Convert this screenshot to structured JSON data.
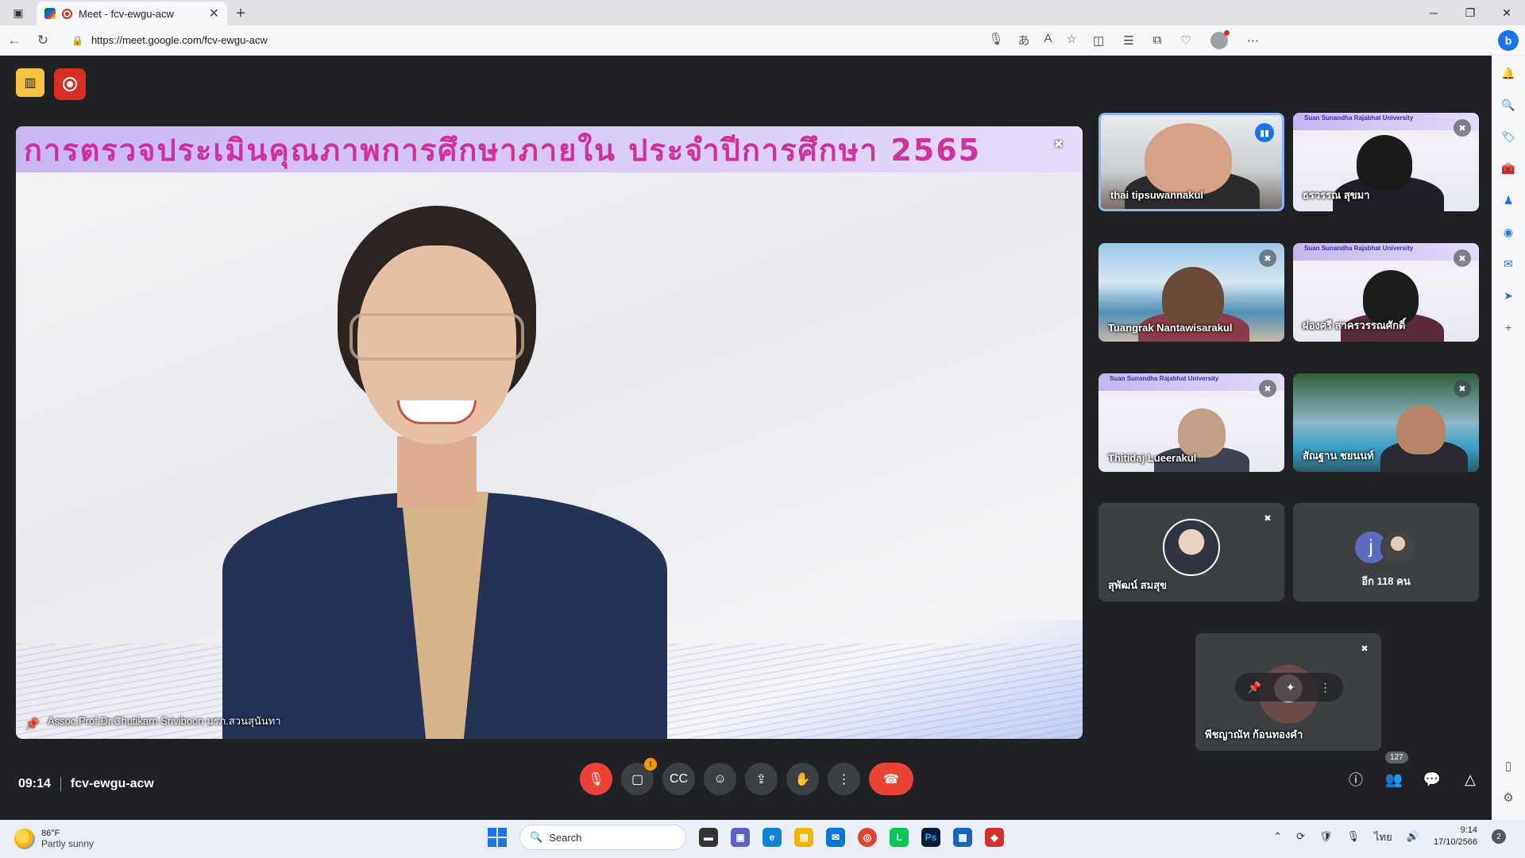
{
  "browser": {
    "tab_title": "Meet - fcv-ewgu-acw",
    "url": "https://meet.google.com/fcv-ewgu-acw",
    "new_tab_symbol": "+",
    "close_symbol": "✕"
  },
  "meeting": {
    "time": "09:14",
    "code": "fcv-ewgu-acw",
    "participant_count": "127"
  },
  "main_video": {
    "banner_text": "การตรวจประเมินคุณภาพการศึกษาภายใน ประจำปีการศึกษา 2565",
    "speaker_name": "Assoc.Prof.Dr.Chutikarn Sriviboon มรภ.สวนสุนันทา"
  },
  "tiles": [
    {
      "name": "thai tipsuwannakul",
      "state": "speaking"
    },
    {
      "name": "ธรวรรณ สุขมา",
      "state": "muted"
    },
    {
      "name": "Tuangrak Nantawisarakul",
      "state": "muted"
    },
    {
      "name": "ผ่องศรี สาครวรรณศักดิ์",
      "state": "muted"
    },
    {
      "name": "Thitidaj Lueerakul",
      "state": "muted"
    },
    {
      "name": "สัณฐาน ชยนนท์",
      "state": "muted"
    },
    {
      "name": "สุพัฒน์ สมสุข",
      "state": "muted"
    }
  ],
  "slide_band_text": "Suan Sunandha Rajabhat University",
  "more_tile": {
    "label": "อีก 118 คน",
    "avatar_letter": "j"
  },
  "self_tile": {
    "name": "พีชญาณัท ก้อนทองคำ"
  },
  "taskbar": {
    "temp": "86°F",
    "weather": "Partly sunny",
    "search_label": "Search",
    "clock_time": "9:14",
    "clock_date": "17/10/2566",
    "lang": "ไทย",
    "notification_count": "2"
  },
  "colors": {
    "meet_bg": "#202124",
    "tile_bg": "#3c4043",
    "end_call": "#ea4335",
    "speaking": "#1a73e8",
    "banner_text": "#d02f9e"
  }
}
